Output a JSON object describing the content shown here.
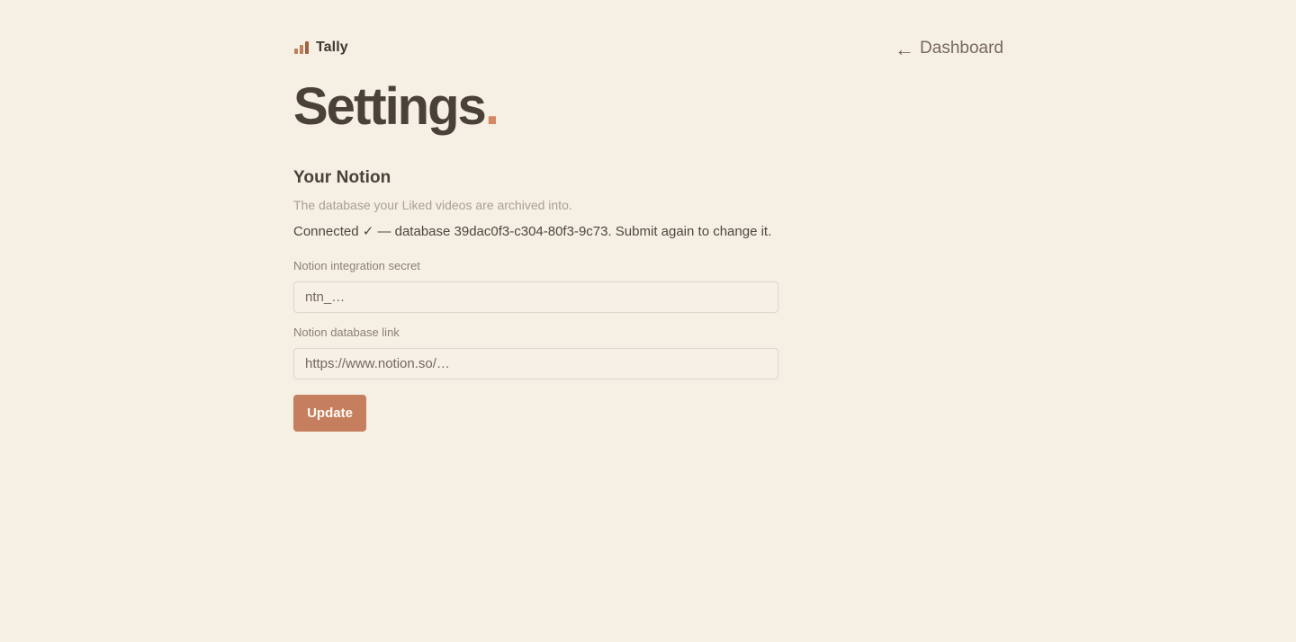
{
  "header": {
    "brand_name": "Tally",
    "brand_icon": "bar-chart-icon",
    "back_icon": "←",
    "back_label": "Dashboard"
  },
  "page": {
    "title": "Settings",
    "title_punctuation": "."
  },
  "notion_section": {
    "title": "Your Notion",
    "description": "The database your Liked videos are archived into.",
    "status_text": "Connected ✓ — database 39dac0f3-c304-80f3-9c73. Submit again to change it.",
    "fields": {
      "secret": {
        "label": "Notion integration secret",
        "value": "",
        "placeholder": "ntn_…"
      },
      "database_link": {
        "label": "Notion database link",
        "value": "",
        "placeholder": "https://www.notion.so/…"
      }
    },
    "submit_label": "Update"
  },
  "colors": {
    "background": "#f5efe4",
    "accent": "#c57f5e",
    "text": "#4a4238",
    "muted_text": "#aa9f92"
  }
}
